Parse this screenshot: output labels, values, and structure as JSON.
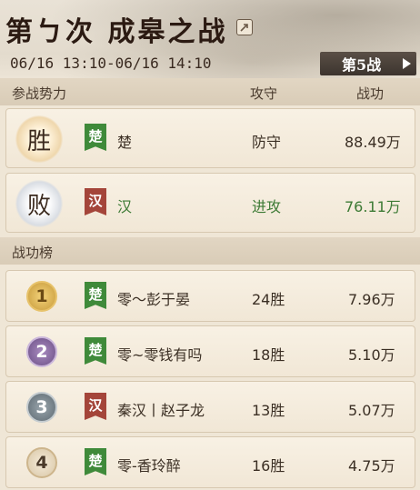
{
  "header": {
    "title": "第ㄅ次 成皋之战",
    "time_range": "06/16 13:10-06/16 14:10",
    "battle_button": "第5战"
  },
  "factions_section": {
    "col_faction": "参战势力",
    "col_role": "攻守",
    "col_merit": "战功",
    "rows": [
      {
        "result": "胜",
        "badge": "楚",
        "name": "楚",
        "role": "防守",
        "merit": "88.49万",
        "badge_color": "#3f8a3a",
        "text_color": "#3b2f24"
      },
      {
        "result": "败",
        "badge": "汉",
        "name": "汉",
        "role": "进攻",
        "merit": "76.11万",
        "badge_color": "#a4453a",
        "text_color": "#3c7a34"
      }
    ]
  },
  "ranking": {
    "title": "战功榜",
    "rows": [
      {
        "rank": "1",
        "badge": "楚",
        "player": "零～彭于晏",
        "wins": "24胜",
        "merit": "7.96万"
      },
      {
        "rank": "2",
        "badge": "楚",
        "player": "零~零钱有吗",
        "wins": "18胜",
        "merit": "5.10万"
      },
      {
        "rank": "3",
        "badge": "汉",
        "player": "秦汉丨赵子龙",
        "wins": "13胜",
        "merit": "5.07万"
      },
      {
        "rank": "4",
        "badge": "楚",
        "player": "零-香玲醉",
        "wins": "16胜",
        "merit": "4.75万"
      }
    ]
  },
  "colors": {
    "chu": "#3f8a3a",
    "han": "#a4453a",
    "accent_green": "#3c7a34"
  }
}
